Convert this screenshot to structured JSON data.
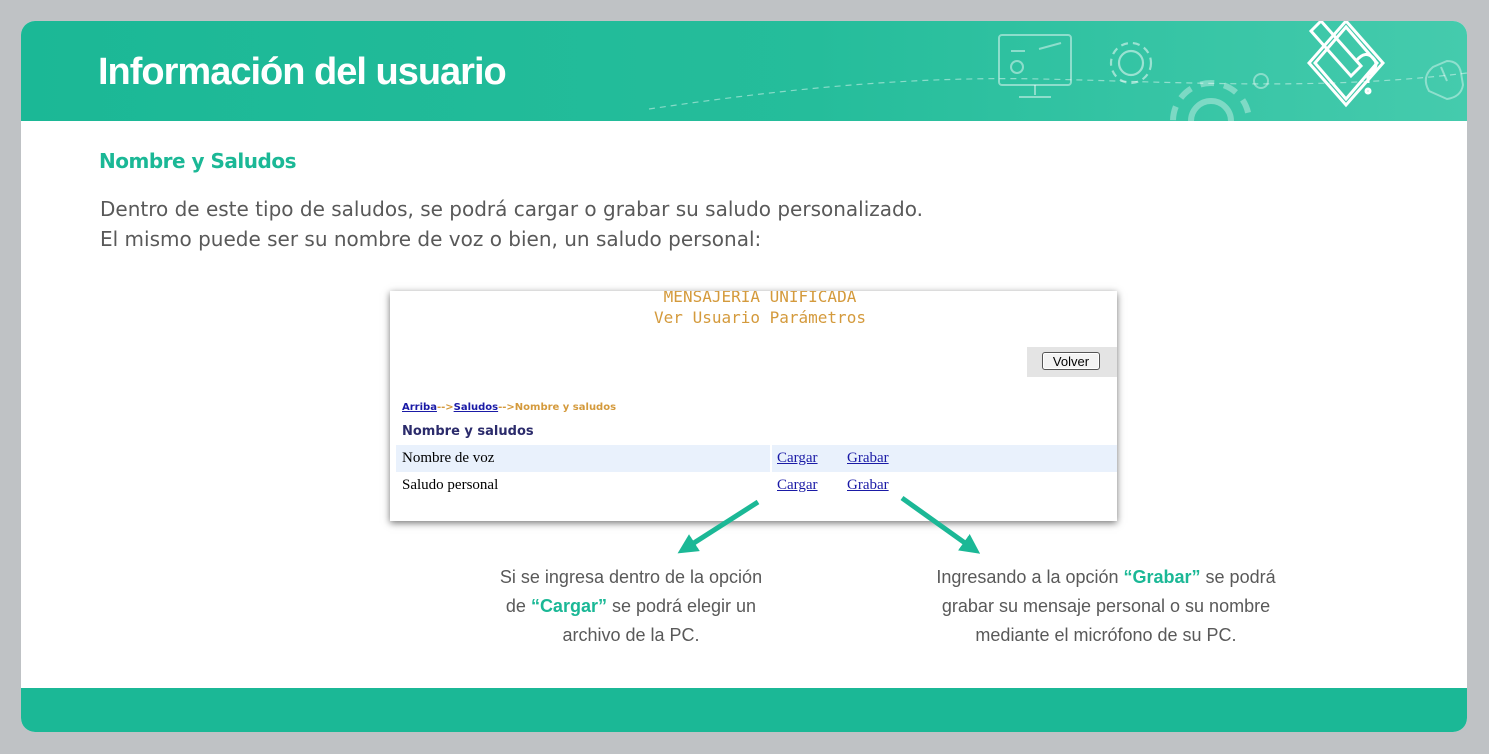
{
  "header": {
    "title": "Información del usuario"
  },
  "section": {
    "title": "Nombre y Saludos",
    "intro_line1": "Dentro de este tipo de saludos, se podrá cargar o grabar su saludo personalizado.",
    "intro_line2": "El mismo puede ser su nombre de voz o bien, un saludo personal:"
  },
  "screenshot": {
    "title_line1": "MENSAJERIA UNIFICADA",
    "title_line2": "Ver Usuario Parámetros",
    "volver_label": "Volver",
    "breadcrumb": {
      "item1": "Arriba",
      "sep1": "-->",
      "item2": "Saludos",
      "sep2": "-->",
      "current": "Nombre y saludos"
    },
    "panel_heading": "Nombre y saludos",
    "rows": [
      {
        "label": "Nombre de voz",
        "link1": "Cargar",
        "link2": "Grabar"
      },
      {
        "label": "Saludo personal",
        "link1": "Cargar",
        "link2": "Grabar"
      }
    ]
  },
  "callouts": {
    "cargar": {
      "line1": "Si se ingresa dentro de la opción",
      "line2_pre": "de ",
      "line2_bold": "“Cargar”",
      "line2_post": " se podrá elegir un",
      "line3": "archivo de la PC."
    },
    "grabar": {
      "line1_pre": "Ingresando a la opción ",
      "line1_bold": "“Grabar”",
      "line1_post": " se podrá",
      "line2": "grabar su mensaje personal o su nombre",
      "line3": "mediante el micrófono de su PC."
    }
  },
  "colors": {
    "accent": "#1bb896",
    "body_text": "#595959",
    "screenshot_title": "#d49a3c",
    "link": "#1a1aa6",
    "row_highlight": "#e9f1fc"
  }
}
